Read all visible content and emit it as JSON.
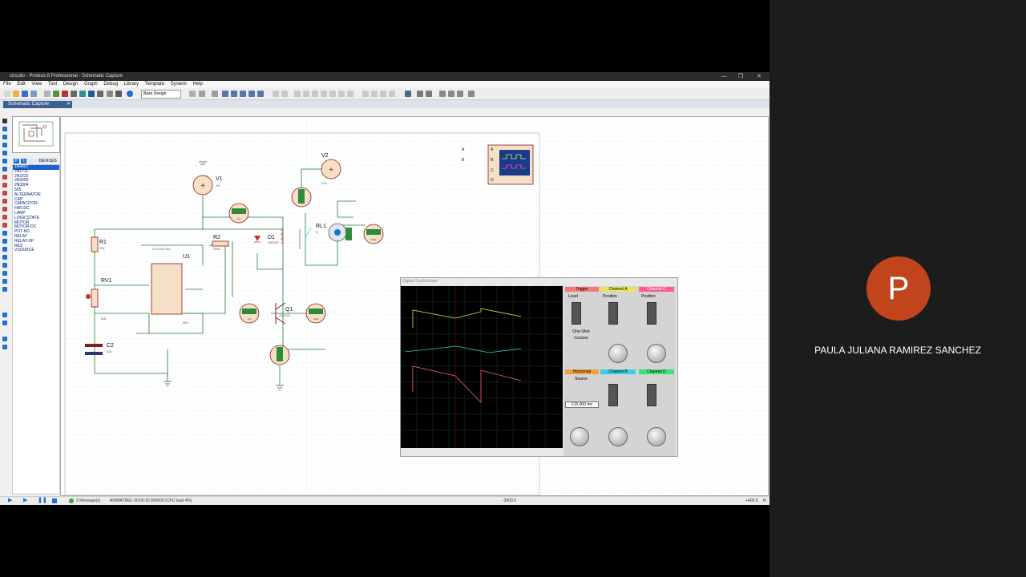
{
  "window": {
    "title": "circuito - Proteus 8 Professional - Schematic Capture",
    "controls": {
      "minimize": "—",
      "restore": "❐",
      "close": "✕"
    }
  },
  "menu": [
    "File",
    "Edit",
    "View",
    "Tool",
    "Design",
    "Graph",
    "Debug",
    "Library",
    "Template",
    "System",
    "Help"
  ],
  "toolbar": {
    "design_select": "Base Design"
  },
  "tab": {
    "label": "Schematic Capture",
    "close": "✕"
  },
  "devices": {
    "mode_p": "P",
    "mode_l": "L",
    "header": "DEVICES",
    "items": [
      "1N4007",
      "2N1711",
      "2N2222",
      "2N3055",
      "2N3904",
      "555",
      "ALTERNATOR",
      "CAP",
      "CAPACITOR",
      "FAN-DC",
      "LAMP",
      "LOGICSTATE",
      "MOTOR",
      "MOTOR-DC",
      "POT-HG",
      "RELAY",
      "RELAY-SP",
      "RES",
      "VSOURCE"
    ],
    "selected_index": 0
  },
  "schematic": {
    "v1": "V1",
    "v1_val": "9V",
    "v2": "V2",
    "v2_val": "12V",
    "r1": "R1",
    "r1_val": "20k",
    "r2": "R2",
    "r2_val": "2500",
    "rv1": "RV1",
    "rv1_val": "50k",
    "c2": "C2",
    "c2_val": "22u",
    "u1": "U1",
    "u1_type": "555",
    "d1": "D1",
    "d1_type": "1N4007",
    "rl1": "RL1",
    "rl1_val": "5",
    "q1": "Q1",
    "q1_type": "2N2222",
    "meter_v": "Volts",
    "meter_ma": "mA",
    "probe": "V=1.67e-011"
  },
  "scope_block": {
    "pins": [
      "A",
      "B",
      "C",
      "D"
    ]
  },
  "oscilloscope": {
    "title": "Digital Oscilloscope",
    "channel_a": "Channel A",
    "channel_b": "Channel B",
    "channel_c": "Channel C",
    "channel_d": "Channel D",
    "horizontal": "Horizontal",
    "trigger": "Trigger",
    "level": "Level",
    "position": "Position",
    "source": "Source",
    "one_shot": "One-Shot",
    "cursors": "Cursors",
    "time_readout": "215.000 ms"
  },
  "status": {
    "messages": "2 Message(s)",
    "animating": "ANIMATING: 00:00:15.950000 (CPU load 4%)",
    "coord_x": "-3600.0",
    "coord_y": "+400.0",
    "unit": "th"
  },
  "participant": {
    "initial": "P",
    "name": "PAULA JULIANA RAMIREZ SANCHEZ",
    "avatar_color": "#c1441c"
  },
  "colors": {
    "channel_a": "#e6e65c",
    "channel_b": "#3ccfe0",
    "channel_c": "#ff5c8a",
    "channel_d": "#3fe07a",
    "wire": "#1f7a30",
    "component": "#8b1a1a"
  }
}
